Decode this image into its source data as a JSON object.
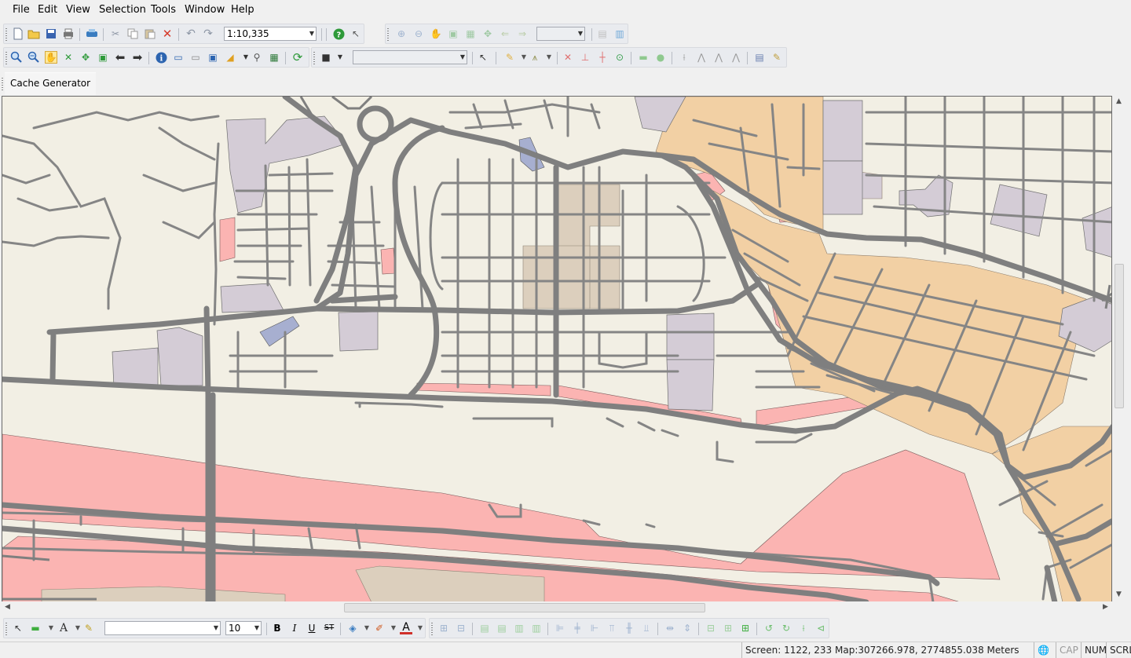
{
  "menu": [
    "File",
    "Edit",
    "View",
    "Selection",
    "Tools",
    "Window",
    "Help"
  ],
  "toolbar": {
    "scale_value": "1:10,335",
    "font_size": "10",
    "text_bold": "B",
    "text_italic": "I",
    "text_underline": "U",
    "text_strike": "ST"
  },
  "tabs": [
    "Cache Generator"
  ],
  "status": {
    "screen": "Screen: 1122, 233",
    "map": "Map:307266.978, 2774855.038 Meters",
    "cap": "CAP",
    "num": "NUM",
    "scrl": "SCRL"
  },
  "colors": {
    "map_background": "#f2efe4",
    "road": "#7f7f7f",
    "industrial_pink": "#fbb4b2",
    "residential_orange": "#f2d0a4",
    "building_lavender": "#d4ccd6",
    "commercial_tan": "#dccfbd",
    "terminal_blue": "#a7afd0"
  }
}
